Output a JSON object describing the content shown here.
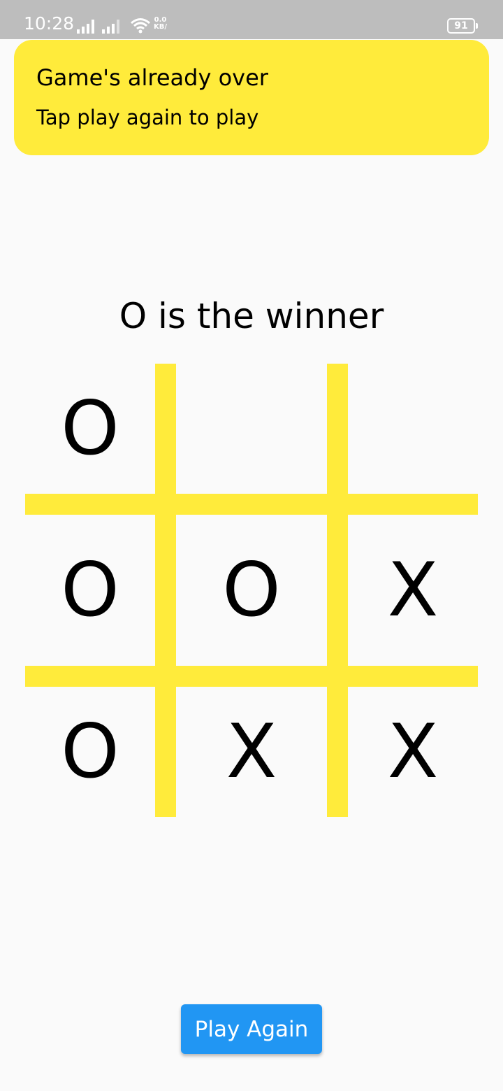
{
  "status_bar": {
    "time": "10:28",
    "net_speed_value": "0.0",
    "net_speed_unit": "KB/",
    "battery": "91"
  },
  "snackbar": {
    "title": "Game's already over",
    "subtitle": "Tap play again to play"
  },
  "game": {
    "winner_text": "O is the winner",
    "board": [
      "O",
      "",
      "",
      "O",
      "O",
      "X",
      "O",
      "X",
      "X"
    ]
  },
  "actions": {
    "play_again_label": "Play Again"
  },
  "colors": {
    "accent_yellow": "#ffeb3b",
    "button_blue": "#2196f3",
    "background": "#fafafa",
    "status_bar": "#bdbdbd"
  }
}
